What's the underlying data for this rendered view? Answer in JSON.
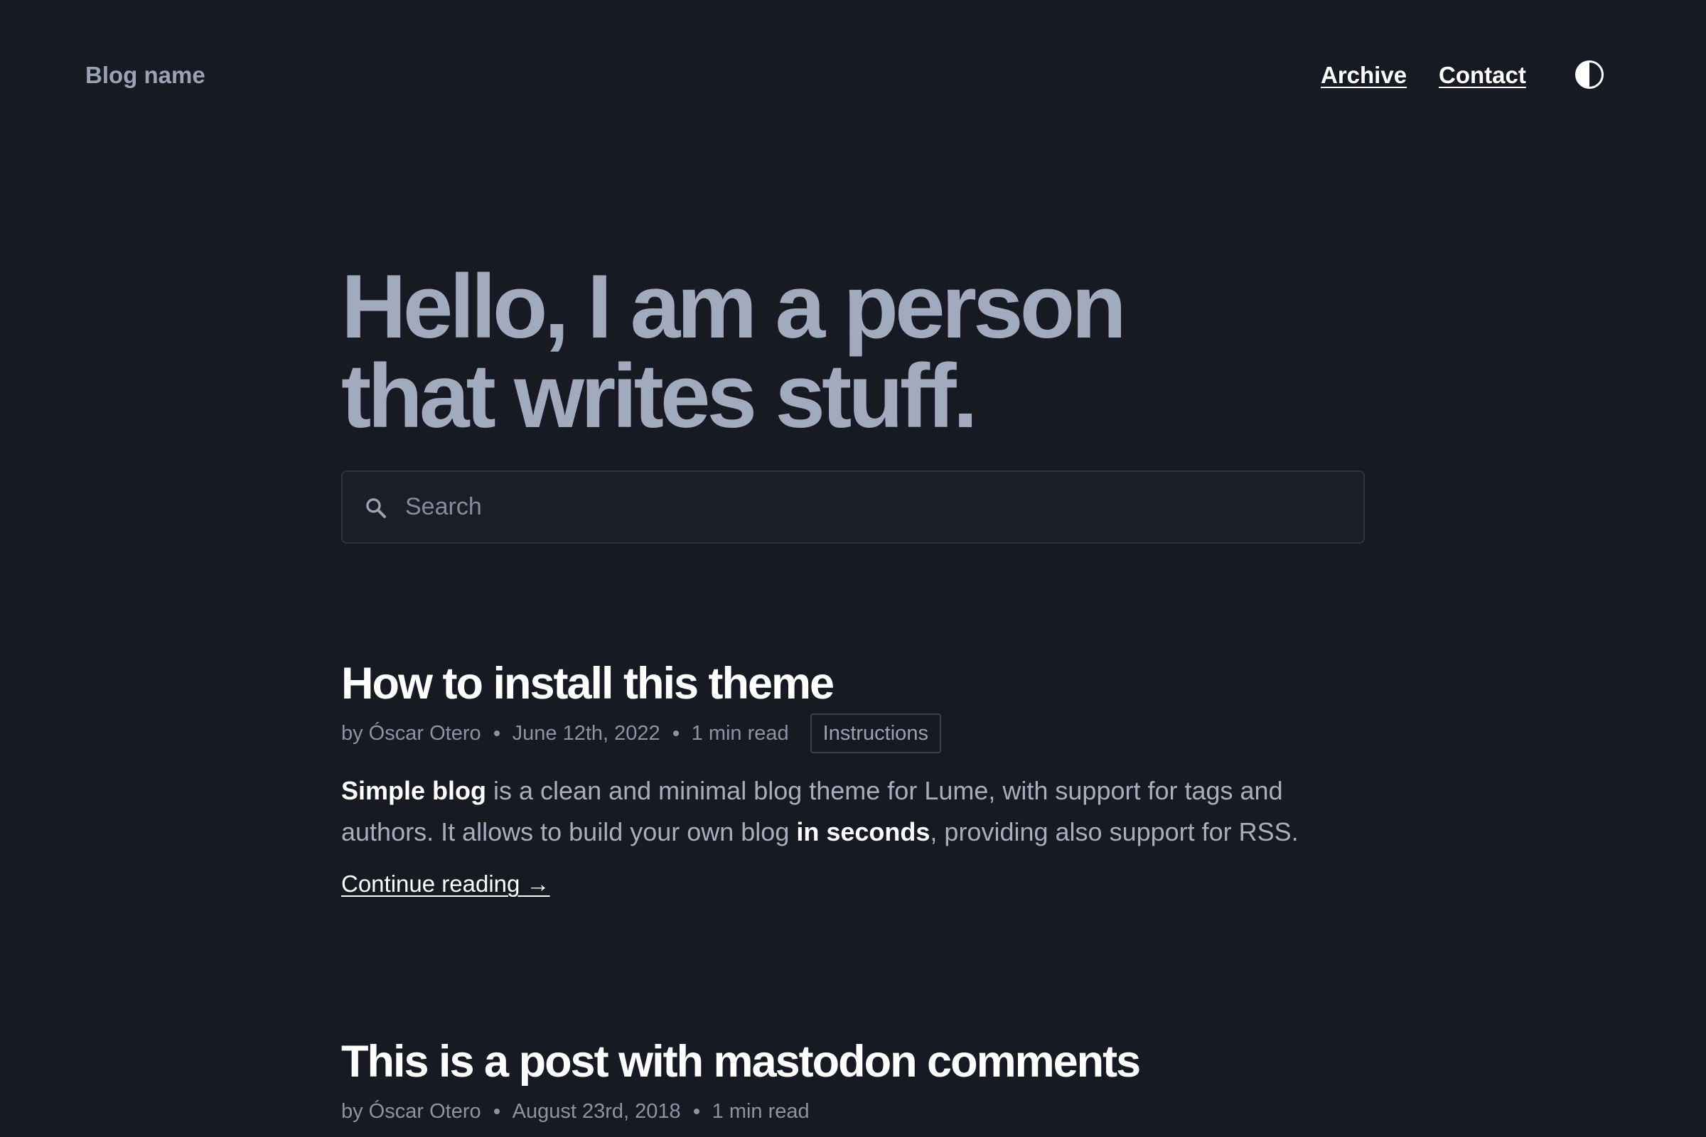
{
  "header": {
    "brand": "Blog name",
    "nav": [
      {
        "label": "Archive"
      },
      {
        "label": "Contact"
      }
    ],
    "theme_toggle_icon": "half-circle-contrast-icon"
  },
  "hero": {
    "title": "Hello, I am a person\nthat writes stuff."
  },
  "search": {
    "placeholder": "Search",
    "icon": "search-icon"
  },
  "posts": [
    {
      "title": "How to install this theme",
      "author": "by Óscar Otero",
      "date": "June 12th, 2022",
      "read_time": "1 min read",
      "tag": "Instructions",
      "excerpt": {
        "bold1": "Simple blog",
        "text1": " is a clean and minimal blog theme for Lume, with support for tags and authors. It allows to build your own blog ",
        "bold2": "in seconds",
        "text2": ", providing also support for RSS."
      },
      "continue_label": "Continue reading →"
    },
    {
      "title": "This is a post with mastodon comments",
      "author": "by Óscar Otero",
      "date": "August 23rd, 2018",
      "read_time": "1 min read"
    }
  ],
  "colors": {
    "background": "#171a22",
    "hero_text": "#a2aabd",
    "muted_text": "#8c93a4",
    "heading_text": "#ffffff"
  }
}
